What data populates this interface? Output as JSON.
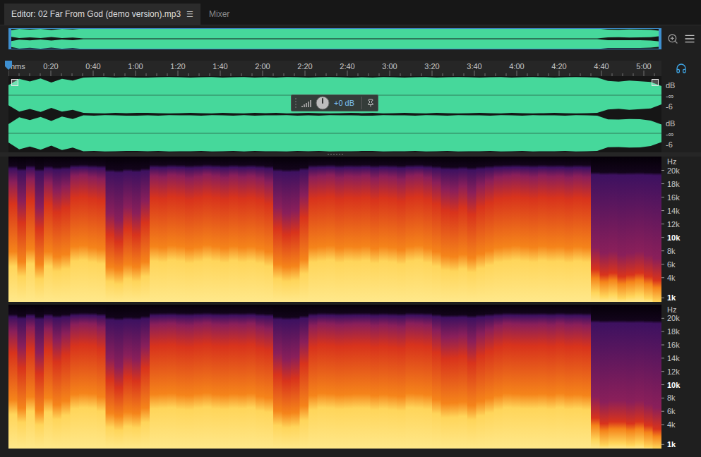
{
  "window": {
    "title": "Editor: 02 Far From God (demo version).mp3"
  },
  "tabs": [
    {
      "label": "Editor: 02 Far From God (demo version).mp3",
      "selected": true,
      "menu": "☰"
    },
    {
      "label": "Mixer",
      "selected": false
    }
  ],
  "ruler": {
    "unit": "hms",
    "labels": [
      "0:20",
      "0:40",
      "1:00",
      "1:20",
      "1:40",
      "2:00",
      "2:20",
      "2:40",
      "3:00",
      "3:20",
      "3:40",
      "4:00",
      "4:20",
      "4:40",
      "5:00"
    ]
  },
  "hud": {
    "reading": "+0 dB",
    "level": 0.5
  },
  "waveform": {
    "channels": [
      {
        "scale": [
          "dB",
          "-∞",
          "-6"
        ],
        "envelope": [
          0.55,
          0.9,
          0.75,
          0.92,
          0.7,
          0.9,
          0.8,
          0.97,
          0.98,
          0.99,
          0.97,
          0.98,
          0.96,
          0.97,
          0.98,
          0.99,
          0.98,
          0.97,
          0.98,
          0.99,
          0.97,
          0.98,
          0.99,
          0.96,
          0.98,
          0.97,
          0.99,
          0.98,
          0.97,
          0.98,
          0.99,
          0.98,
          0.97,
          0.98,
          0.96,
          0.99,
          0.98,
          0.97,
          0.98,
          0.99,
          0.97,
          0.98,
          0.99,
          0.98,
          0.97,
          0.98,
          0.99,
          0.97,
          0.98,
          0.99,
          0.98,
          0.97,
          0.98,
          0.99,
          0.98,
          0.97,
          0.78,
          0.74,
          0.8,
          0.76,
          0.72,
          0.5
        ]
      },
      {
        "scale": [
          "dB",
          "-∞",
          "-6"
        ],
        "envelope": [
          0.5,
          0.88,
          0.72,
          0.9,
          0.68,
          0.92,
          0.78,
          0.98,
          0.97,
          0.99,
          0.98,
          0.97,
          0.96,
          0.98,
          0.97,
          0.99,
          0.98,
          0.98,
          0.97,
          0.99,
          0.98,
          0.97,
          0.99,
          0.97,
          0.98,
          0.98,
          0.99,
          0.97,
          0.98,
          0.97,
          0.99,
          0.98,
          0.98,
          0.97,
          0.97,
          0.99,
          0.98,
          0.98,
          0.97,
          0.99,
          0.98,
          0.97,
          0.99,
          0.98,
          0.98,
          0.97,
          0.99,
          0.98,
          0.97,
          0.99,
          0.98,
          0.98,
          0.97,
          0.99,
          0.98,
          0.97,
          0.76,
          0.75,
          0.78,
          0.77,
          0.7,
          0.48
        ]
      }
    ]
  },
  "spectrogram": {
    "unit": "Hz",
    "max_hz": 22050,
    "min_hz": 400,
    "ticks": [
      {
        "label": "20k",
        "value": 20000,
        "major": false
      },
      {
        "label": "18k",
        "value": 18000,
        "major": false
      },
      {
        "label": "16k",
        "value": 16000,
        "major": false
      },
      {
        "label": "14k",
        "value": 14000,
        "major": false
      },
      {
        "label": "12k",
        "value": 12000,
        "major": false
      },
      {
        "label": "10k",
        "value": 10000,
        "major": true
      },
      {
        "label": "8k",
        "value": 8000,
        "major": false
      },
      {
        "label": "6k",
        "value": 6000,
        "major": false
      },
      {
        "label": "4k",
        "value": 4000,
        "major": false
      },
      {
        "label": "1k",
        "value": 1000,
        "major": true
      }
    ],
    "channels": [
      {
        "energy": [
          0.7,
          0.5,
          0.75,
          0.45,
          0.7,
          0.6,
          0.65,
          0.8,
          0.82,
          0.78,
          0.75,
          0.4,
          0.35,
          0.45,
          0.4,
          0.5,
          0.8,
          0.78,
          0.82,
          0.8,
          0.76,
          0.79,
          0.83,
          0.8,
          0.77,
          0.81,
          0.78,
          0.8,
          0.76,
          0.7,
          0.45,
          0.4,
          0.42,
          0.55,
          0.78,
          0.8,
          0.82,
          0.77,
          0.8,
          0.79,
          0.81,
          0.76,
          0.8,
          0.78,
          0.74,
          0.8,
          0.82,
          0.77,
          0.7,
          0.62,
          0.6,
          0.65,
          0.58,
          0.66,
          0.72,
          0.78,
          0.8,
          0.82,
          0.8,
          0.78,
          0.81,
          0.79,
          0.8,
          0.77,
          0.8,
          0.78,
          0.18,
          0.15,
          0.16,
          0.14,
          0.15,
          0.16,
          0.14,
          0.12
        ]
      },
      {
        "energy": [
          0.68,
          0.52,
          0.74,
          0.47,
          0.72,
          0.58,
          0.66,
          0.79,
          0.81,
          0.8,
          0.74,
          0.42,
          0.36,
          0.44,
          0.41,
          0.52,
          0.79,
          0.8,
          0.81,
          0.78,
          0.77,
          0.8,
          0.82,
          0.79,
          0.78,
          0.8,
          0.79,
          0.81,
          0.75,
          0.72,
          0.46,
          0.41,
          0.43,
          0.56,
          0.77,
          0.81,
          0.8,
          0.78,
          0.79,
          0.8,
          0.8,
          0.77,
          0.79,
          0.77,
          0.75,
          0.81,
          0.8,
          0.78,
          0.69,
          0.61,
          0.62,
          0.64,
          0.57,
          0.65,
          0.71,
          0.77,
          0.81,
          0.8,
          0.79,
          0.79,
          0.8,
          0.78,
          0.81,
          0.78,
          0.79,
          0.77,
          0.17,
          0.14,
          0.15,
          0.15,
          0.14,
          0.15,
          0.13,
          0.11
        ]
      }
    ]
  }
}
